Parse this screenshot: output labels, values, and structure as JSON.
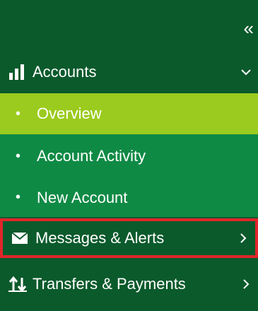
{
  "sidebar": {
    "collapse_glyph": "«",
    "items": [
      {
        "label": "Accounts",
        "icon": "bar-chart-icon",
        "state": "expanded"
      },
      {
        "label": "Messages & Alerts",
        "icon": "envelope-icon",
        "state": "collapsed"
      },
      {
        "label": "Transfers & Payments",
        "icon": "transfer-arrows-icon",
        "state": "collapsed"
      }
    ],
    "accounts_subitems": [
      {
        "label": "Overview",
        "selected": true
      },
      {
        "label": "Account Activity",
        "selected": false
      },
      {
        "label": "New Account",
        "selected": false
      }
    ]
  },
  "colors": {
    "sidebar_bg": "#0b5a2c",
    "subnav_bg": "#0f8a45",
    "selected_bg": "#9bcb1e",
    "highlight_border": "#e0262b",
    "text": "#ffffff"
  }
}
